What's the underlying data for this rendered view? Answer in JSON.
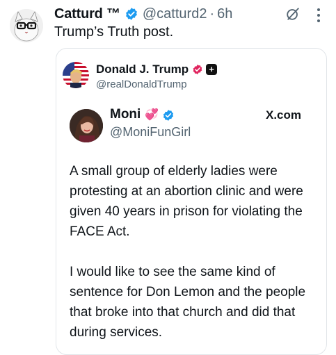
{
  "tweet": {
    "author_name": "Catturd ™",
    "handle": "@catturd2",
    "separator": "·",
    "time": "6h",
    "text": "Trump’s Truth post."
  },
  "quote": {
    "author_name": "Donald J. Trump",
    "handle": "@realDonaldTrump"
  },
  "embedded_post": {
    "author_name": "Moni",
    "author_emoji": "💞",
    "handle": "@MoniFunGirl",
    "source": "X.com",
    "paragraphs": [
      "A small group of elderly ladies were protesting at an abortion clinic and were given 40 years in prison for violating the FACE Act.",
      "I would like to see the same kind of sentence for Don Lemon and the people that broke into that church and did that during services."
    ]
  },
  "icons": {
    "verified_badge": "verified-badge-icon",
    "gov_badge": "government-badge-icon",
    "grok": "grok-icon",
    "more": "more-options-icon"
  },
  "colors": {
    "verified_blue": "#1d9bf0",
    "pink_badge": "#e0245e",
    "secondary_text": "#536471"
  }
}
